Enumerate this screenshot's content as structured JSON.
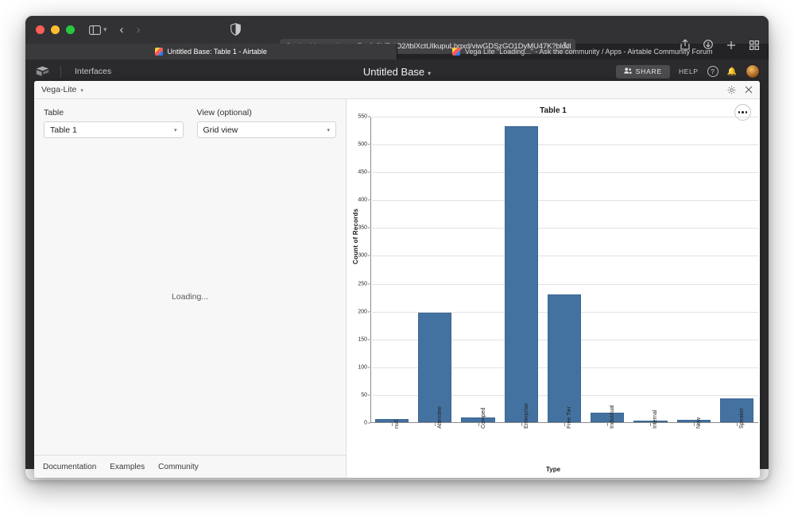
{
  "browser": {
    "url": "airtable.com/appcx7yz6rSVZzIO2/tblXctUIkupuLhgxd/viwGDSzGO1DyMU47K?blocks=blixig",
    "lock_icon": "lock-icon",
    "reload_icon": "reload-icon",
    "sidebar_icon": "sidebar-toggle-icon",
    "shield_icon": "privacy-shield-icon",
    "back_arrow": "‹",
    "forward_arrow": "›",
    "toolbar_icons": [
      "share-icon",
      "download-icon",
      "new-tab-icon",
      "tab-overview-icon"
    ],
    "tabs": [
      {
        "label": "Untitled Base: Table 1 - Airtable",
        "active": true
      },
      {
        "label": "Vega Lite \"Loading...\" - Ask the community / Apps - Airtable Community Forum",
        "active": false
      }
    ]
  },
  "airtable_header": {
    "logo_icon": "airtable-logo-icon",
    "interfaces_label": "Interfaces",
    "base_title": "Untitled Base",
    "base_caret": "▾",
    "share_label": "SHARE",
    "share_icon": "share-people-icon",
    "help_label": "HELP",
    "help_icon": "question-circle-icon",
    "bell_icon": "bell-icon",
    "avatar": "user-avatar"
  },
  "app_panel": {
    "name": "Vega-Lite",
    "name_caret": "▾",
    "settings_icon": "gear-icon",
    "close_icon": "close-icon"
  },
  "settings": {
    "table_field": {
      "label": "Table",
      "value": "Table 1",
      "caret": "▾"
    },
    "view_field": {
      "label": "View (optional)",
      "value": "Grid view",
      "caret": "▾"
    },
    "loading_text": "Loading...",
    "footer_links": [
      "Documentation",
      "Examples",
      "Community"
    ]
  },
  "chart_panel": {
    "kebab_icon": "more-options-icon"
  },
  "chart_data": {
    "type": "bar",
    "title": "Table 1",
    "xlabel": "Type",
    "ylabel": "Count of Records",
    "ylim": [
      0,
      550
    ],
    "yticks": [
      0,
      50,
      100,
      150,
      200,
      250,
      300,
      350,
      400,
      450,
      500,
      550
    ],
    "grid": true,
    "legend": null,
    "bar_color": "#4472a0",
    "categories": [
      "null",
      "Attendee",
      "Comped",
      "Enterprise",
      "Free Tier",
      "Individual",
      "Internal",
      "New",
      "Speaker"
    ],
    "values": [
      6,
      197,
      9,
      532,
      230,
      17,
      1,
      5,
      43
    ]
  }
}
